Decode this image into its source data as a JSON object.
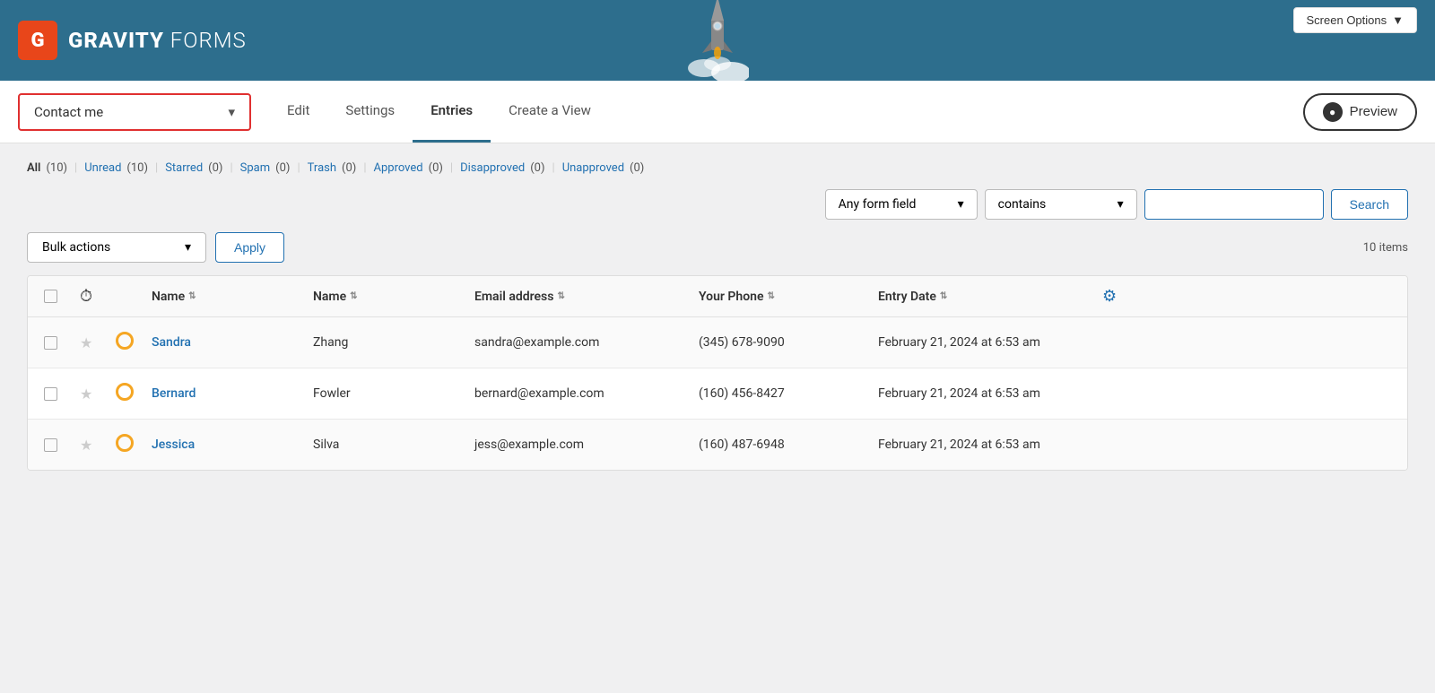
{
  "header": {
    "logo_letter": "G",
    "logo_bold": "GRAVITY",
    "logo_light": " FORMS"
  },
  "screen_options": {
    "label": "Screen Options",
    "arrow": "▼"
  },
  "nav": {
    "form_selector": {
      "value": "Contact me",
      "arrow": "▾"
    },
    "links": [
      {
        "id": "edit",
        "label": "Edit",
        "active": false
      },
      {
        "id": "settings",
        "label": "Settings",
        "active": false
      },
      {
        "id": "entries",
        "label": "Entries",
        "active": true
      },
      {
        "id": "create-view",
        "label": "Create a View",
        "active": false
      }
    ],
    "preview_label": "Preview"
  },
  "filters": {
    "all": "All",
    "all_count": "(10)",
    "unread": "Unread",
    "unread_count": "(10)",
    "starred": "Starred",
    "starred_count": "(0)",
    "spam": "Spam",
    "spam_count": "(0)",
    "trash": "Trash",
    "trash_count": "(0)",
    "approved": "Approved",
    "approved_count": "(0)",
    "disapproved": "Disapproved",
    "disapproved_count": "(0)",
    "unapproved": "Unapproved",
    "unapproved_count": "(0)"
  },
  "search": {
    "field_label": "Any form field",
    "field_arrow": "▾",
    "condition_label": "contains",
    "condition_arrow": "▾",
    "input_placeholder": "",
    "button_label": "Search"
  },
  "actions": {
    "bulk_label": "Bulk actions",
    "bulk_arrow": "▾",
    "apply_label": "Apply",
    "items_count": "10 items"
  },
  "table": {
    "columns": [
      {
        "id": "checkbox",
        "label": ""
      },
      {
        "id": "indicator",
        "label": ""
      },
      {
        "id": "status",
        "label": ""
      },
      {
        "id": "first-name",
        "label": "Name",
        "sortable": true
      },
      {
        "id": "last-name",
        "label": "Name",
        "sortable": true
      },
      {
        "id": "email",
        "label": "Email address",
        "sortable": true
      },
      {
        "id": "phone",
        "label": "Your Phone",
        "sortable": true
      },
      {
        "id": "entry-date",
        "label": "Entry Date",
        "sortable": true
      },
      {
        "id": "settings",
        "label": ""
      }
    ],
    "rows": [
      {
        "first_name": "Sandra",
        "last_name": "Zhang",
        "email": "sandra@example.com",
        "phone": "(345) 678-9090",
        "entry_date": "February 21, 2024 at 6:53 am"
      },
      {
        "first_name": "Bernard",
        "last_name": "Fowler",
        "email": "bernard@example.com",
        "phone": "(160) 456-8427",
        "entry_date": "February 21, 2024 at 6:53 am"
      },
      {
        "first_name": "Jessica",
        "last_name": "Silva",
        "email": "jess@example.com",
        "phone": "(160) 487-6948",
        "entry_date": "February 21, 2024 at 6:53 am"
      }
    ]
  }
}
